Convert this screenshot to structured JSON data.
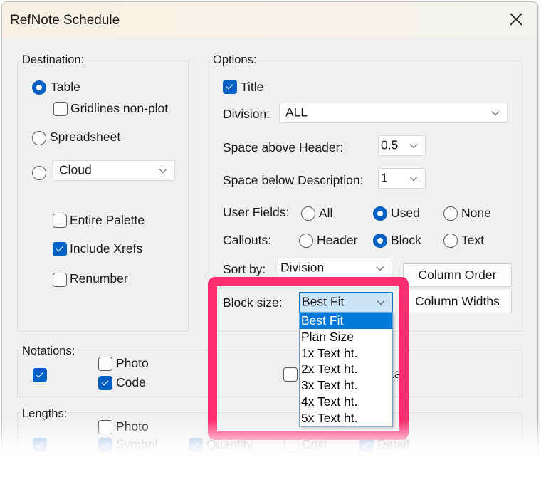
{
  "window": {
    "title": "RefNote Schedule",
    "close_icon": "close-icon"
  },
  "destination": {
    "label": "Destination:",
    "table_label": "Table",
    "table_selected": true,
    "gridlines_label": "Gridlines non-plot",
    "gridlines_checked": false,
    "spreadsheet_label": "Spreadsheet",
    "spreadsheet_selected": false,
    "cloud_selected": false,
    "cloud_value": "Cloud",
    "entire_palette_label": "Entire Palette",
    "entire_palette_checked": false,
    "include_xrefs_label": "Include Xrefs",
    "include_xrefs_checked": true,
    "renumber_label": "Renumber",
    "renumber_checked": false
  },
  "options": {
    "label": "Options:",
    "title_label": "Title",
    "title_checked": true,
    "division_label": "Division:",
    "division_value": "ALL",
    "space_above_label": "Space above Header:",
    "space_above_value": "0.5",
    "space_below_label": "Space below Description:",
    "space_below_value": "1",
    "user_fields_label": "User Fields:",
    "user_fields_options": [
      "All",
      "Used",
      "None"
    ],
    "user_fields_selected": "Used",
    "callouts_label": "Callouts:",
    "callouts_options": [
      "Header",
      "Block",
      "Text"
    ],
    "callouts_selected": "Block",
    "sort_by_label": "Sort by:",
    "sort_by_value": "Division",
    "column_order_button": "Column Order",
    "column_widths_button": "Column Widths",
    "block_size_label": "Block size:",
    "block_size_value": "Best Fit",
    "block_size_options": [
      "Best Fit",
      "Plan Size",
      "1x Text ht.",
      "2x Text ht.",
      "3x Text ht.",
      "4x Text ht.",
      "5x Text ht."
    ],
    "block_size_selected_index": 0
  },
  "notations": {
    "label": "Notations:",
    "main_checked": true,
    "photo_label": "Photo",
    "photo_checked": false,
    "code_label": "Code",
    "code_checked": true,
    "detail_partial": "tail",
    "detail_checked": false
  },
  "lengths": {
    "label": "Lengths:",
    "photo_label": "Photo",
    "photo_checked": false,
    "symbol_label": "Symbol",
    "quantity_label": "Quantity",
    "cost_label": "Cost",
    "detail_label": "Detail"
  },
  "colors": {
    "accent": "#0160c4",
    "highlight": "#ff2d6f",
    "selection": "#0078d7"
  }
}
